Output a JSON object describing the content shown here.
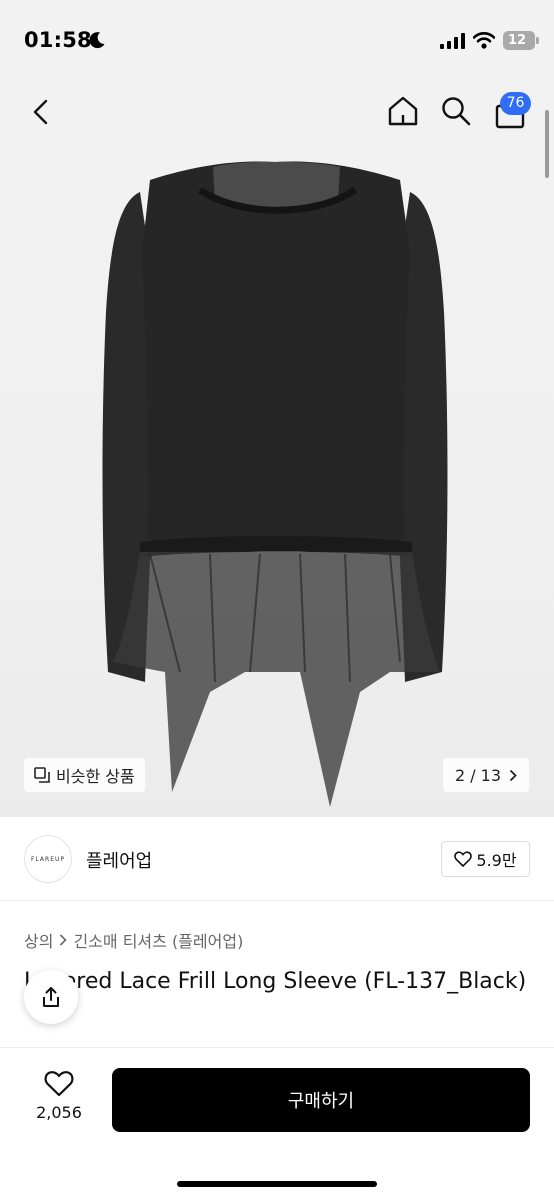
{
  "status_bar": {
    "time": "01:58",
    "battery": "12"
  },
  "nav": {
    "cart_badge": "76"
  },
  "gallery": {
    "similar_label": "비슷한 상품",
    "counter": "2 / 13"
  },
  "brand": {
    "logo_text": "FLAREUP",
    "name": "플레어업",
    "likes": "5.9만"
  },
  "breadcrumb": {
    "items": [
      "상의",
      "긴소매 티셔츠 (플레어업)"
    ]
  },
  "product": {
    "title": "Layered Lace Frill Long Sleeve (FL-137_Black)"
  },
  "bottom_bar": {
    "wish_count": "2,056",
    "buy_label": "구매하기"
  },
  "icons": {
    "back": "chevron-left-icon",
    "home": "home-icon",
    "search": "search-icon",
    "cart": "shopping-bag-icon",
    "similar": "copy-icon",
    "counter": "chevron-right-icon",
    "like": "heart-icon",
    "share": "share-icon"
  },
  "colors": {
    "badge": "#2f6df6",
    "buy_button": "#000000",
    "background": "#f2f2f2"
  }
}
